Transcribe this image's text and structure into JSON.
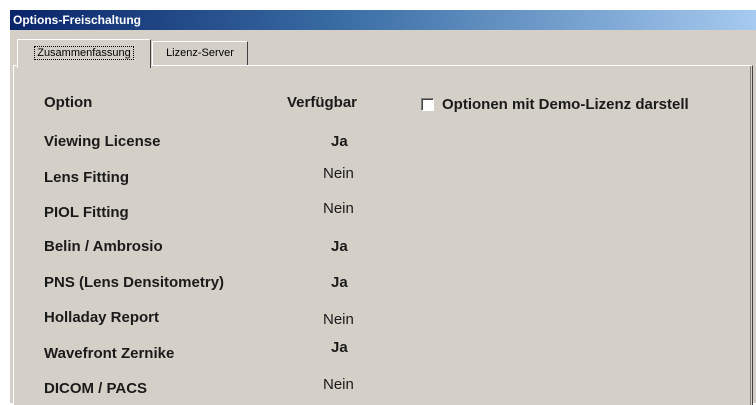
{
  "window": {
    "title": "Options-Freischaltung"
  },
  "tabs": [
    {
      "label": "Zusammenfassung",
      "active": true
    },
    {
      "label": "Lizenz-Server",
      "active": false
    }
  ],
  "table": {
    "headers": {
      "option": "Option",
      "available": "Verfügbar"
    },
    "rows": [
      {
        "option": "Viewing License",
        "available": "Ja"
      },
      {
        "option": "Lens Fitting",
        "available": "Nein"
      },
      {
        "option": "PIOL Fitting",
        "available": "Nein"
      },
      {
        "option": "Belin / Ambrosio",
        "available": "Ja"
      },
      {
        "option": "PNS (Lens Densitometry)",
        "available": "Ja"
      },
      {
        "option": "Holladay Report",
        "available": "Nein"
      },
      {
        "option": "Wavefront Zernike",
        "available": "Ja"
      },
      {
        "option": "DICOM / PACS",
        "available": "Nein"
      }
    ]
  },
  "demo_checkbox": {
    "label": "Optionen mit Demo-Lizenz darstell",
    "checked": false
  }
}
